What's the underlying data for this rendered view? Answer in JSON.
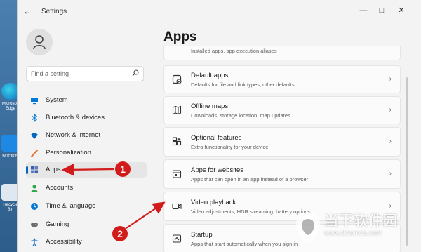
{
  "window": {
    "title": "Settings",
    "back": "←",
    "minimize": "—",
    "maximize": "□",
    "close": "✕"
  },
  "desktop": {
    "labels": [
      "Microsoft Edge",
      "软件管理",
      "Recycle Bin"
    ]
  },
  "search": {
    "placeholder": "Find a setting"
  },
  "sidebar": {
    "items": [
      {
        "label": "System",
        "icon": "monitor-icon",
        "color": "#0078d4"
      },
      {
        "label": "Bluetooth & devices",
        "icon": "bluetooth-icon",
        "color": "#0078d4"
      },
      {
        "label": "Network & internet",
        "icon": "wifi-icon",
        "color": "#0067c0"
      },
      {
        "label": "Personalization",
        "icon": "brush-icon",
        "color": "#e07b39"
      },
      {
        "label": "Apps",
        "icon": "apps-icon",
        "color": "#3a5fa8",
        "selected": true
      },
      {
        "label": "Accounts",
        "icon": "person-icon",
        "color": "#2fa84f"
      },
      {
        "label": "Time & language",
        "icon": "globe-clock-icon",
        "color": "#0078d4"
      },
      {
        "label": "Gaming",
        "icon": "controller-icon",
        "color": "#6b6b6b"
      },
      {
        "label": "Accessibility",
        "icon": "accessibility-icon",
        "color": "#1a73c9"
      }
    ]
  },
  "main": {
    "title": "Apps",
    "cards": [
      {
        "title": "",
        "subtitle": "Installed apps, app execution aliases",
        "icon": ""
      },
      {
        "title": "Default apps",
        "subtitle": "Defaults for file and link types, other defaults",
        "icon": "default-apps-icon"
      },
      {
        "title": "Offline maps",
        "subtitle": "Downloads, storage location, map updates",
        "icon": "map-icon"
      },
      {
        "title": "Optional features",
        "subtitle": "Extra functionality for your device",
        "icon": "plus-grid-icon"
      },
      {
        "title": "Apps for websites",
        "subtitle": "Apps that can open in an app instead of a browser",
        "icon": "web-app-icon"
      },
      {
        "title": "Video playback",
        "subtitle": "Video adjustments, HDR streaming, battery options",
        "icon": "video-icon"
      },
      {
        "title": "Startup",
        "subtitle": "Apps that start automatically when you sign in",
        "icon": "startup-icon"
      }
    ]
  },
  "annotations": {
    "badge1": "1",
    "badge2": "2",
    "color": "#d21c1c"
  },
  "watermark": {
    "name": "当下软件园",
    "url": "www.downxia.com"
  }
}
